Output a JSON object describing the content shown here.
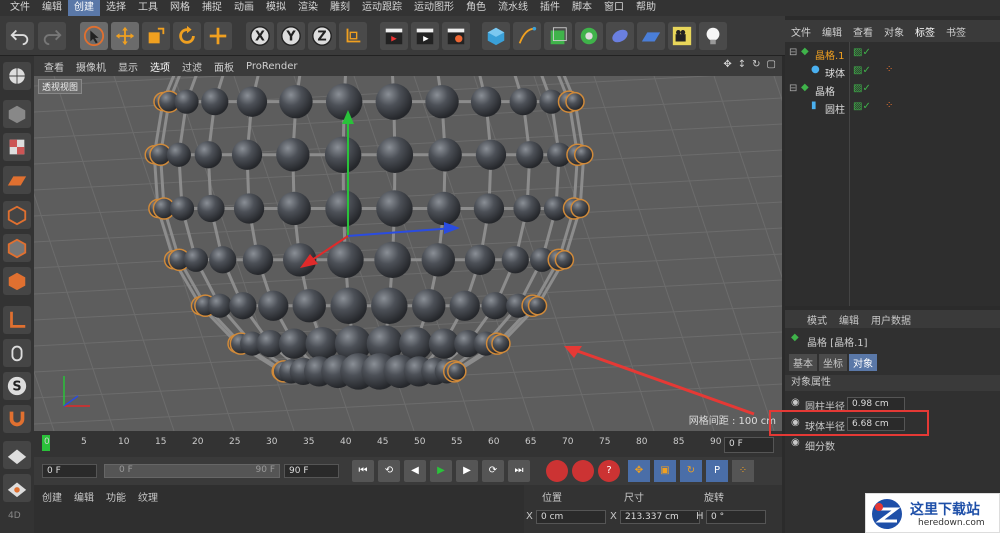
{
  "menu": [
    "文件",
    "编辑",
    "创建",
    "选择",
    "工具",
    "网格",
    "捕捉",
    "动画",
    "模拟",
    "渲染",
    "雕刻",
    "运动跟踪",
    "运动图形",
    "角色",
    "流水线",
    "插件",
    "脚本",
    "窗口",
    "帮助"
  ],
  "menu_active": "创建",
  "viewport": {
    "menu": [
      "查看",
      "摄像机",
      "显示",
      "选项",
      "过滤",
      "面板",
      "ProRender"
    ],
    "label": "透视视图",
    "grid_info": "网格间距 : 100 cm"
  },
  "timeline": {
    "ticks": [
      "0",
      "5",
      "10",
      "15",
      "20",
      "25",
      "30",
      "35",
      "40",
      "45",
      "50",
      "55",
      "60",
      "65",
      "70",
      "75",
      "80",
      "85",
      "90"
    ],
    "frame_value": "0 F"
  },
  "controls": {
    "start": "0 F",
    "range_left": "0 F",
    "range_right": "90 F",
    "end": "90 F"
  },
  "bottom_tabs": [
    "创建",
    "编辑",
    "功能",
    "纹理"
  ],
  "coords": {
    "headers": [
      "位置",
      "尺寸",
      "旋转"
    ],
    "x_label": "X",
    "x_value": "0 cm",
    "x2_label": "X",
    "size_value": "213.337 cm",
    "h_label": "H",
    "h_value": "0 °"
  },
  "object_manager": {
    "tabs": [
      "文件",
      "编辑",
      "查看",
      "对象",
      "标签",
      "书签"
    ],
    "active_tab": "标签",
    "items": [
      {
        "name": "晶格.1",
        "highlight": true
      },
      {
        "name": "球体",
        "highlight": false
      },
      {
        "name": "晶格",
        "highlight": false
      },
      {
        "name": "圆柱",
        "highlight": false
      }
    ]
  },
  "attributes": {
    "tabs": [
      "模式",
      "编辑",
      "用户数据"
    ],
    "object_title": "晶格 [晶格.1]",
    "sub_tabs": [
      "基本",
      "坐标",
      "对象"
    ],
    "active_sub_tab": "对象",
    "section": "对象属性",
    "fields": [
      {
        "label": "圆柱半径",
        "value": "0.98 cm"
      },
      {
        "label": "球体半径",
        "value": "6.68 cm"
      },
      {
        "label": "细分数",
        "value": ""
      }
    ]
  },
  "watermark": {
    "text": "这里下载站",
    "url": "heredown.com"
  },
  "colors": {
    "highlight_box": "#e53935",
    "accent": "#5a78a8",
    "arrow": "#e53935"
  }
}
